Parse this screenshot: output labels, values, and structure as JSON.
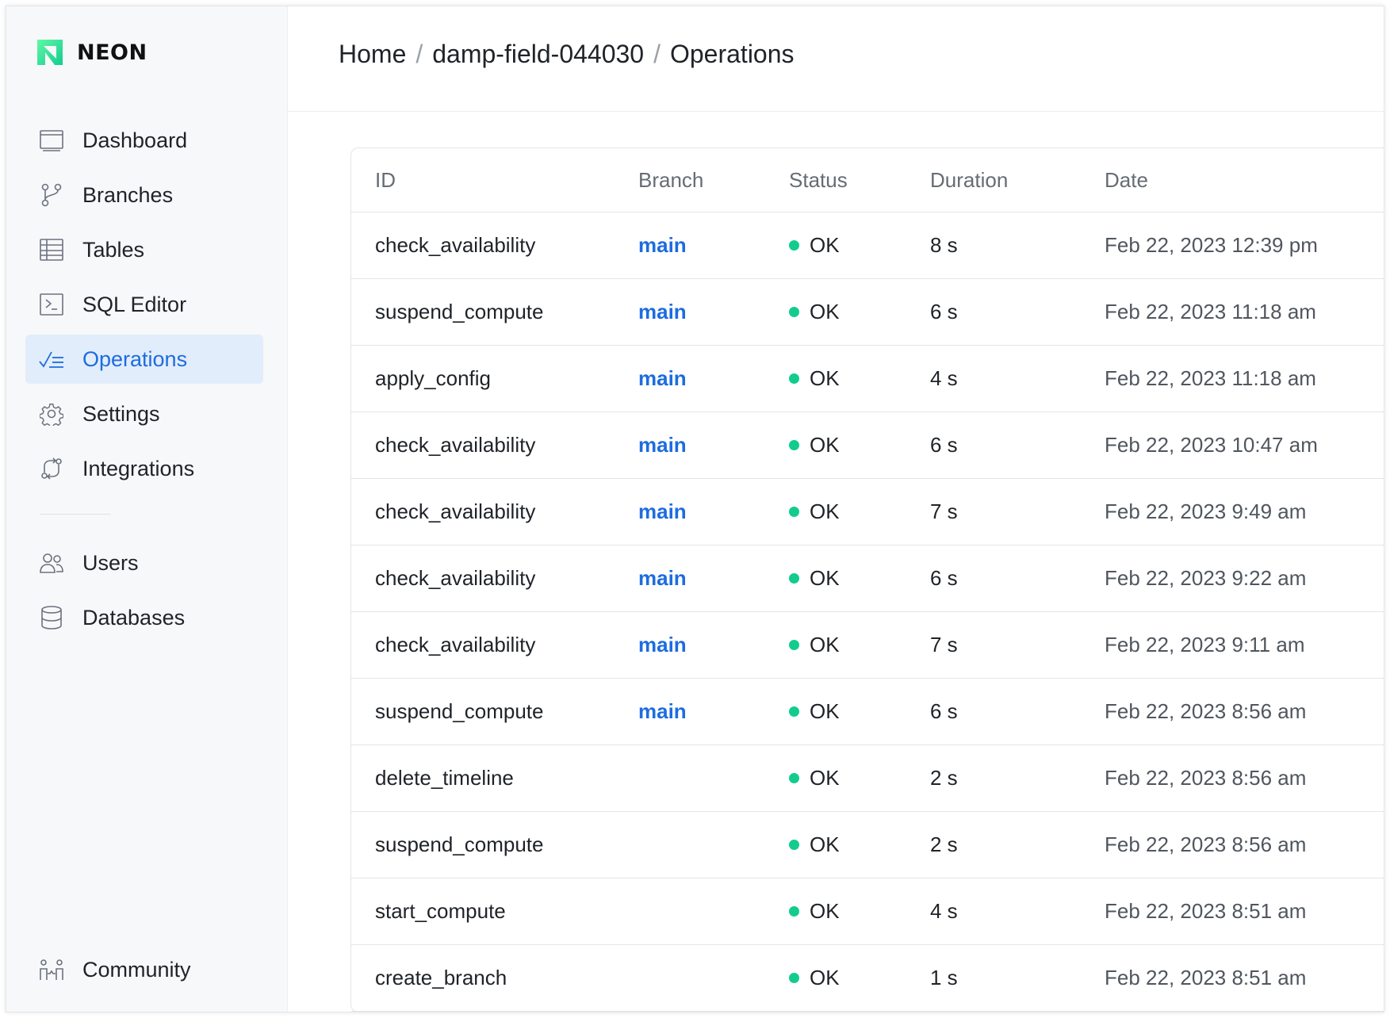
{
  "app": {
    "name": "NEON",
    "accent": "#1d6ce0",
    "brand_green": "#12cc8f"
  },
  "sidebar": {
    "items": [
      {
        "label": "Dashboard",
        "icon": "dashboard-icon"
      },
      {
        "label": "Branches",
        "icon": "branch-icon"
      },
      {
        "label": "Tables",
        "icon": "table-icon"
      },
      {
        "label": "SQL Editor",
        "icon": "terminal-icon"
      },
      {
        "label": "Operations",
        "icon": "operations-icon",
        "active": true
      },
      {
        "label": "Settings",
        "icon": "gear-icon"
      },
      {
        "label": "Integrations",
        "icon": "integrations-icon"
      }
    ],
    "secondary": [
      {
        "label": "Users",
        "icon": "users-icon"
      },
      {
        "label": "Databases",
        "icon": "database-icon"
      }
    ],
    "community": {
      "label": "Community",
      "icon": "community-icon"
    }
  },
  "breadcrumb": {
    "home": "Home",
    "project": "damp-field-044030",
    "current": "Operations",
    "separator": "/"
  },
  "table": {
    "columns": [
      "ID",
      "Branch",
      "Status",
      "Duration",
      "Date"
    ],
    "rows": [
      {
        "id": "check_availability",
        "branch": "main",
        "status": "OK",
        "duration": "8 s",
        "date": "Feb 22, 2023 12:39 pm"
      },
      {
        "id": "suspend_compute",
        "branch": "main",
        "status": "OK",
        "duration": "6 s",
        "date": "Feb 22, 2023 11:18 am"
      },
      {
        "id": "apply_config",
        "branch": "main",
        "status": "OK",
        "duration": "4 s",
        "date": "Feb 22, 2023 11:18 am"
      },
      {
        "id": "check_availability",
        "branch": "main",
        "status": "OK",
        "duration": "6 s",
        "date": "Feb 22, 2023 10:47 am"
      },
      {
        "id": "check_availability",
        "branch": "main",
        "status": "OK",
        "duration": "7 s",
        "date": "Feb 22, 2023 9:49 am"
      },
      {
        "id": "check_availability",
        "branch": "main",
        "status": "OK",
        "duration": "6 s",
        "date": "Feb 22, 2023 9:22 am"
      },
      {
        "id": "check_availability",
        "branch": "main",
        "status": "OK",
        "duration": "7 s",
        "date": "Feb 22, 2023 9:11 am"
      },
      {
        "id": "suspend_compute",
        "branch": "main",
        "status": "OK",
        "duration": "6 s",
        "date": "Feb 22, 2023 8:56 am"
      },
      {
        "id": "delete_timeline",
        "branch": "",
        "status": "OK",
        "duration": "2 s",
        "date": "Feb 22, 2023 8:56 am"
      },
      {
        "id": "suspend_compute",
        "branch": "",
        "status": "OK",
        "duration": "2 s",
        "date": "Feb 22, 2023 8:56 am"
      },
      {
        "id": "start_compute",
        "branch": "",
        "status": "OK",
        "duration": "4 s",
        "date": "Feb 22, 2023 8:51 am"
      },
      {
        "id": "create_branch",
        "branch": "",
        "status": "OK",
        "duration": "1 s",
        "date": "Feb 22, 2023 8:51 am"
      }
    ]
  }
}
